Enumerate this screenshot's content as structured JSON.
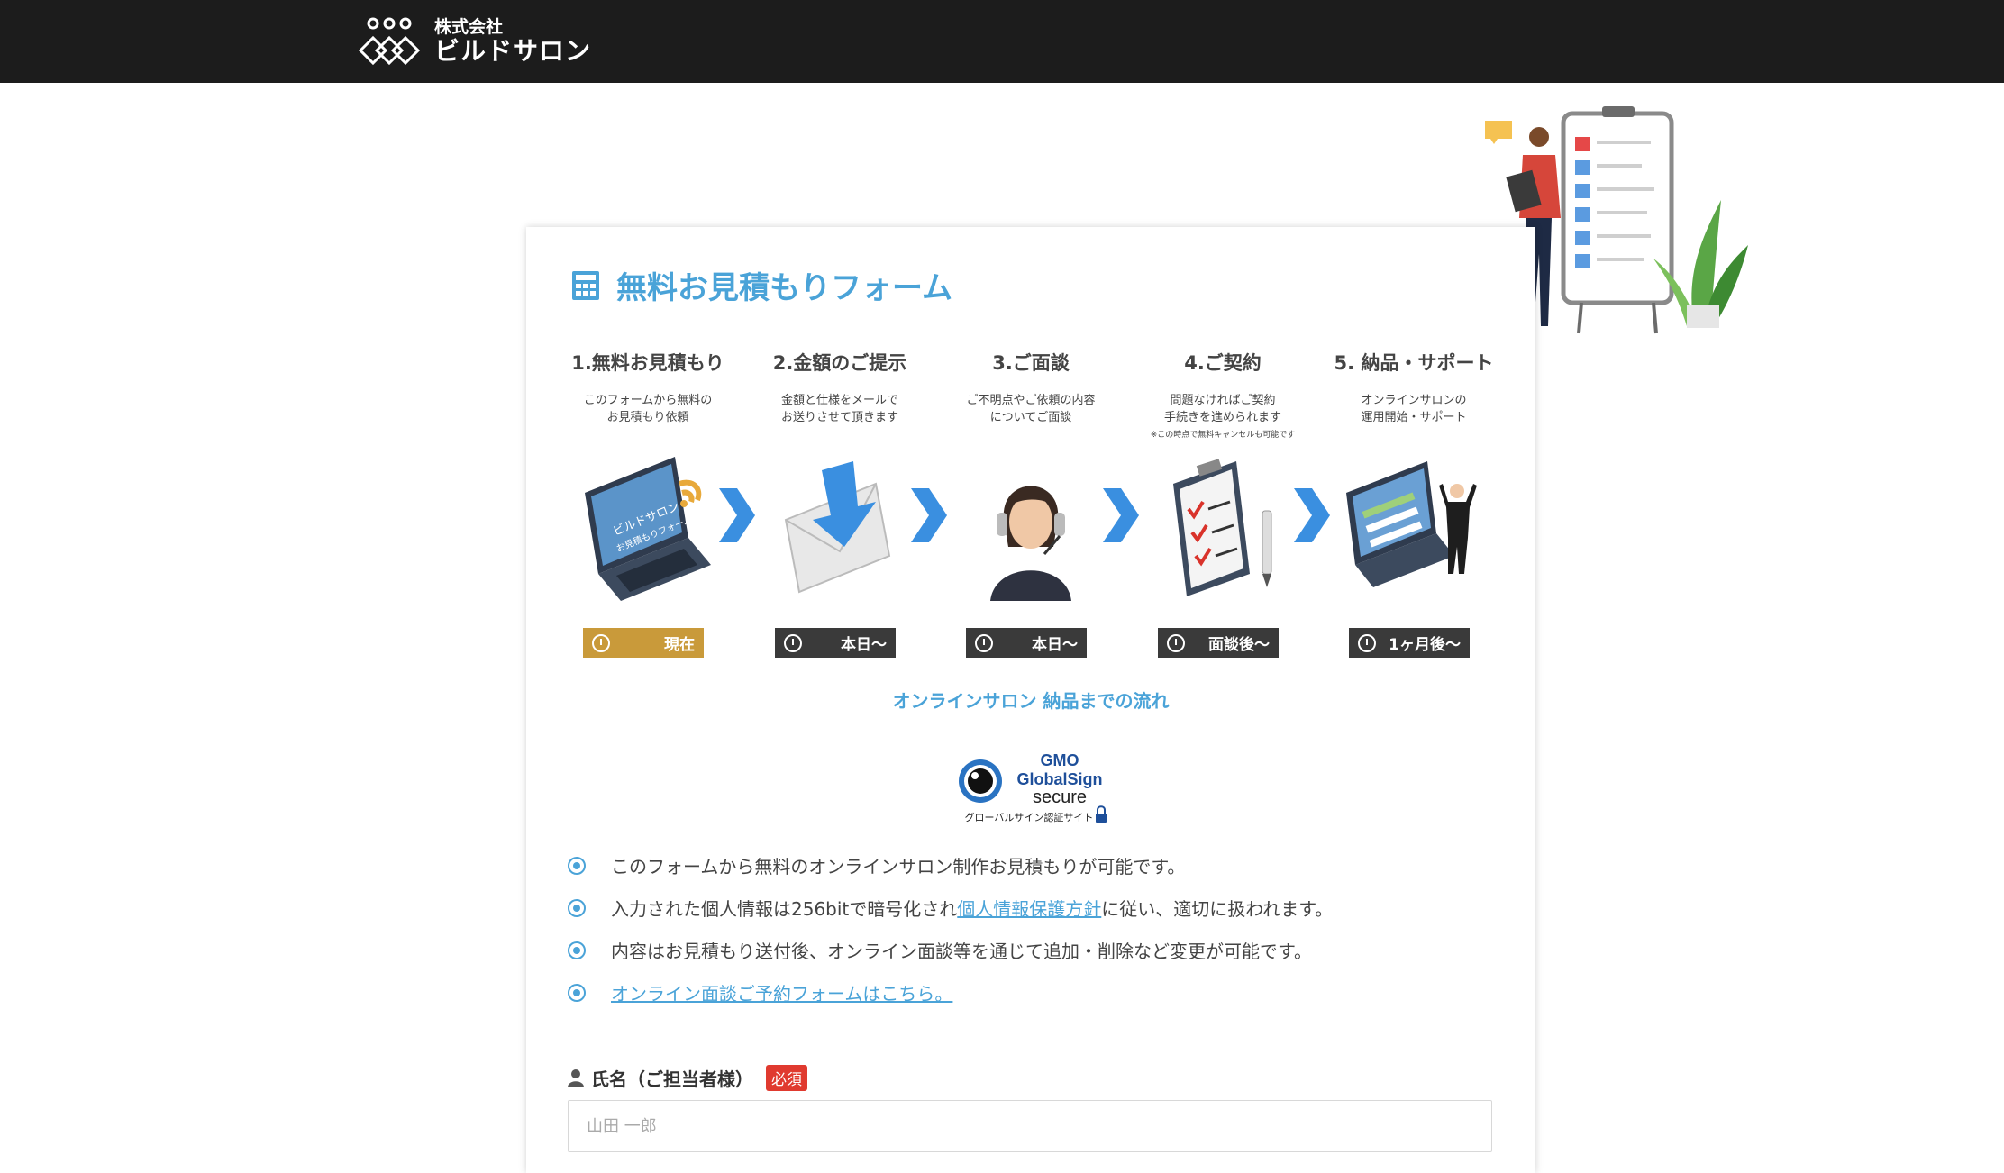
{
  "header": {
    "logo_sub": "株式会社",
    "logo_main": "ビルドサロン"
  },
  "form": {
    "title": "無料お見積もりフォーム",
    "steps": [
      {
        "title": "1.無料お見積もり",
        "desc1": "このフォームから無料の",
        "desc2": "お見積もり依頼",
        "note": "",
        "badge": "現在"
      },
      {
        "title": "2.金額のご提示",
        "desc1": "金額と仕様をメールで",
        "desc2": "お送りさせて頂きます",
        "note": "",
        "badge": "本日〜"
      },
      {
        "title": "3.ご面談",
        "desc1": "ご不明点やご依頼の内容",
        "desc2": "についてご面談",
        "note": "",
        "badge": "本日〜"
      },
      {
        "title": "4.ご契約",
        "desc1": "問題なければご契約",
        "desc2": "手続きを進められます",
        "note": "※この時点で無料キャンセルも可能です",
        "badge": "面談後〜"
      },
      {
        "title": "5. 納品・サポート",
        "desc1": "オンラインサロンの",
        "desc2": "運用開始・サポート",
        "note": "",
        "badge": "1ヶ月後〜"
      }
    ],
    "laptop_screen_text1": "ビルドサロン",
    "laptop_screen_text2": "お見積もりフォーム",
    "flow_caption": "オンラインサロン 納品までの流れ",
    "gmo": {
      "line1": "GMO",
      "line2": "GlobalSign",
      "line3": "secure",
      "line4": "グローバルサイン認証サイト"
    },
    "info": {
      "item1": "このフォームから無料のオンラインサロン制作お見積もりが可能です。",
      "item2_pre": "入力された個人情報は256bitで暗号化され",
      "item2_link": "個人情報保護方針",
      "item2_post": "に従い、適切に扱われます。",
      "item3": "内容はお見積もり送付後、オンライン面談等を通じて追加・削除など変更が可能です。",
      "item4_link": "オンライン面談ご予約フォームはこちら。"
    },
    "name_field": {
      "label": "氏名（ご担当者様）",
      "required": "必須",
      "placeholder": "山田 一郎",
      "value": ""
    }
  },
  "colors": {
    "accent": "#4aa3d8",
    "header_bg": "#1c1c1c",
    "badge_now": "#c99a3a",
    "badge": "#3a3a3a",
    "required": "#e03a2f"
  }
}
